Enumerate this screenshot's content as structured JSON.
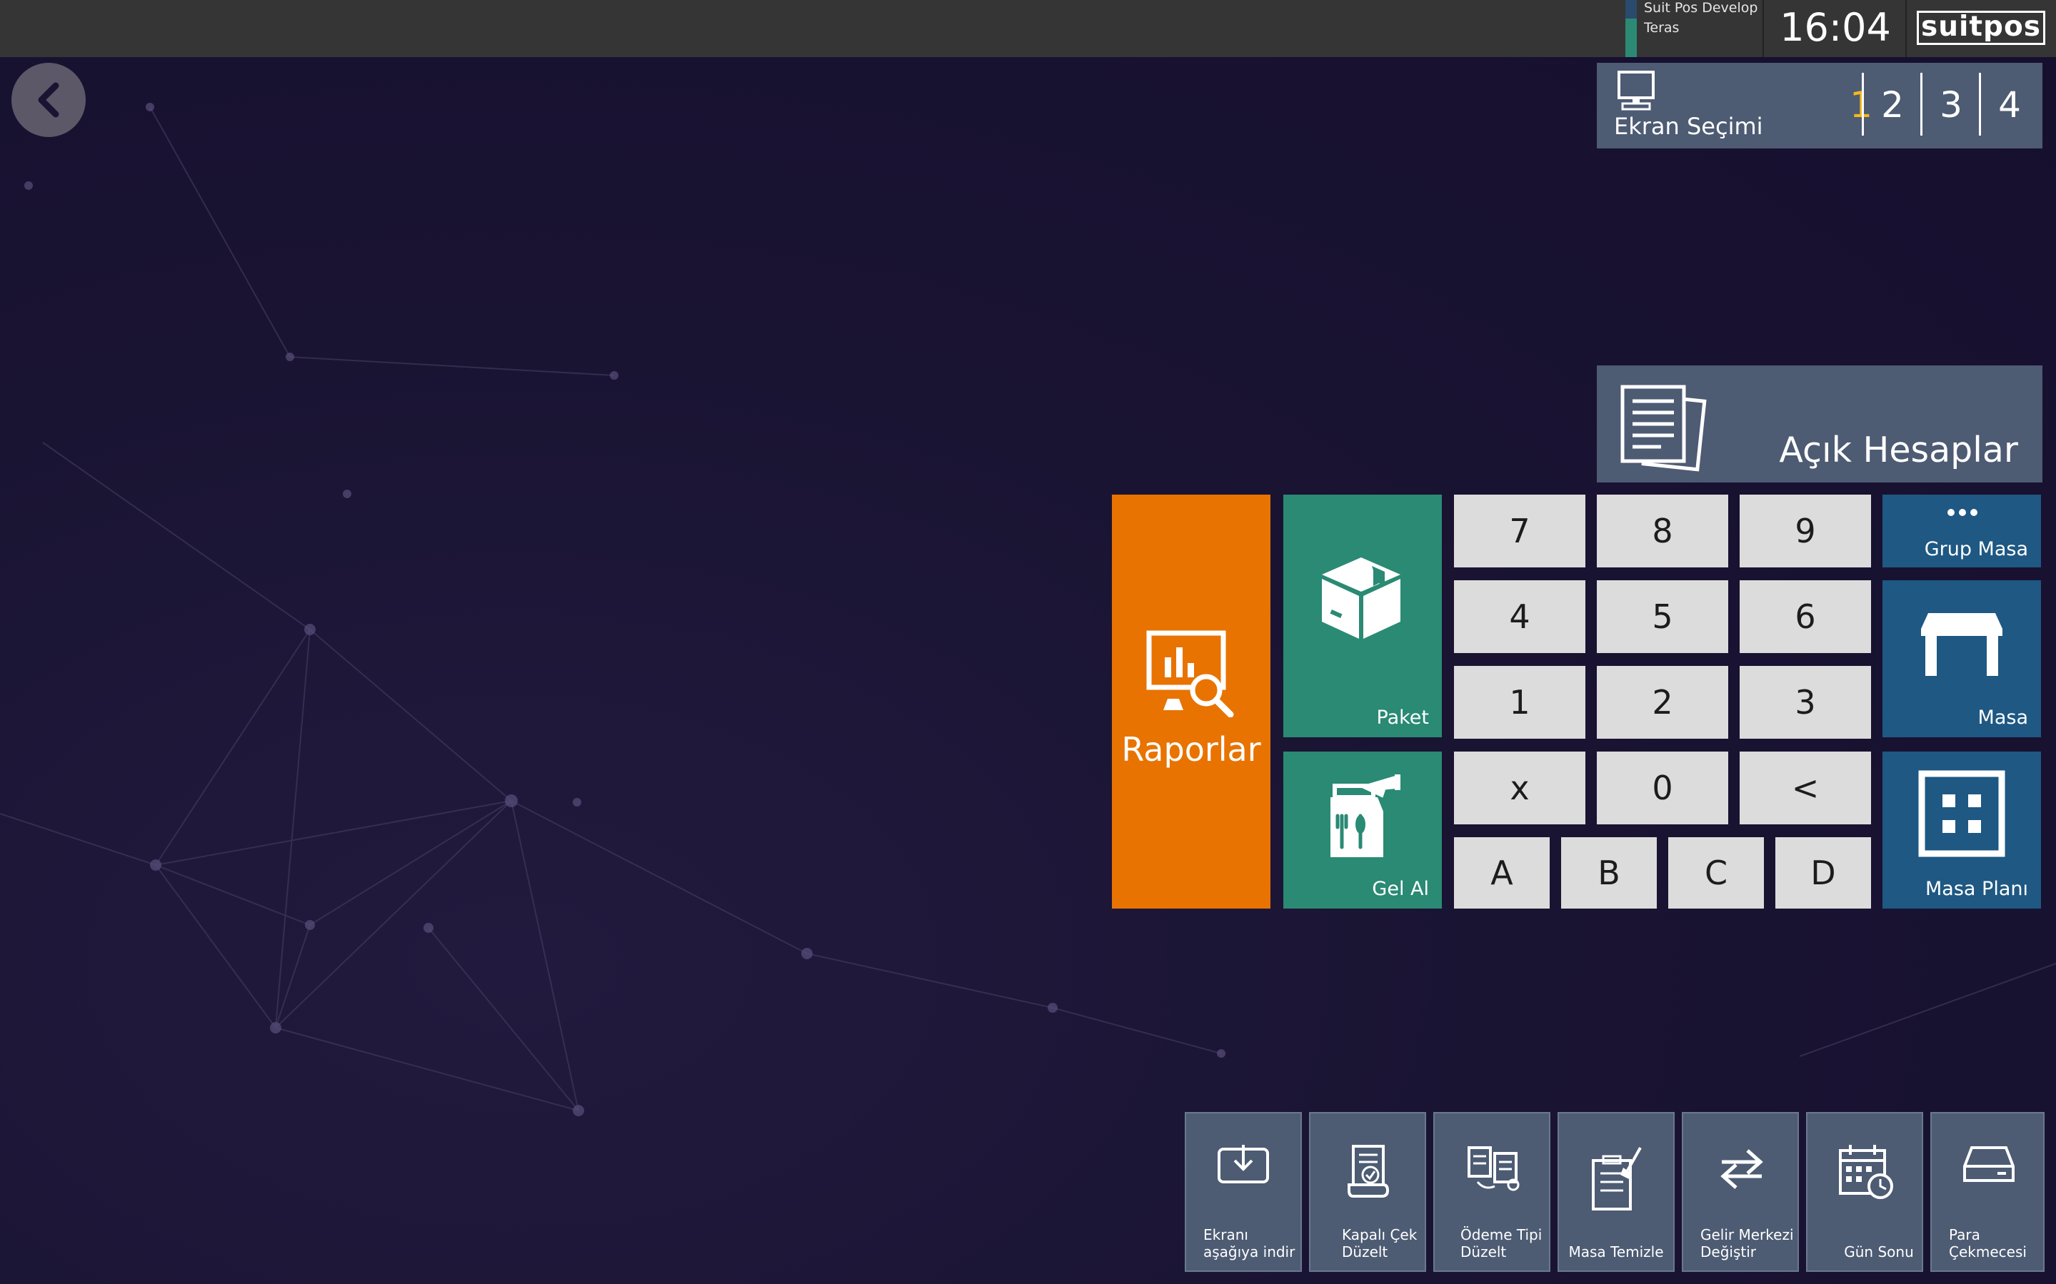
{
  "topbar": {
    "station_line1": "Suit Pos Develop",
    "station_line2": "Teras",
    "clock": "16:04",
    "logo": "suitpos"
  },
  "screen_selector": {
    "label": "Ekran Seçimi",
    "options": [
      "1",
      "2",
      "3",
      "4"
    ],
    "active": "1",
    "active_color": "#f5b91e"
  },
  "open_accounts": {
    "label": "Açık Hesaplar"
  },
  "tiles": {
    "raporlar": "Raporlar",
    "paket": "Paket",
    "gel_al": "Gel Al",
    "grup_masa": "Grup Masa",
    "masa": "Masa",
    "masa_plani": "Masa Planı"
  },
  "keypad": {
    "rows": [
      [
        "7",
        "8",
        "9"
      ],
      [
        "4",
        "5",
        "6"
      ],
      [
        "1",
        "2",
        "3"
      ],
      [
        "x",
        "0",
        "<"
      ]
    ],
    "letters": [
      "A",
      "B",
      "C",
      "D"
    ]
  },
  "bottom_actions": [
    {
      "line1": "Ekranı",
      "line2": "aşağıya indir",
      "icon": "download-tray-icon"
    },
    {
      "line1": "Kapalı Çek",
      "line2": "Düzelt",
      "icon": "receipt-check-icon"
    },
    {
      "line1": "Ödeme Tipi",
      "line2": "Düzelt",
      "icon": "documents-exchange-icon"
    },
    {
      "line1": "",
      "line2": "Masa Temizle",
      "icon": "clipboard-brush-icon"
    },
    {
      "line1": "Gelir Merkezi",
      "line2": "Değiştir",
      "icon": "swap-arrows-icon"
    },
    {
      "line1": "",
      "line2": "Gün Sonu",
      "icon": "calendar-clock-icon"
    },
    {
      "line1": "Para",
      "line2": "Çekmecesi",
      "icon": "cash-drawer-icon"
    }
  ],
  "colors": {
    "orange": "#e87300",
    "green": "#2a8a74",
    "blue": "#1e5883",
    "panel": "#4d5b73"
  }
}
